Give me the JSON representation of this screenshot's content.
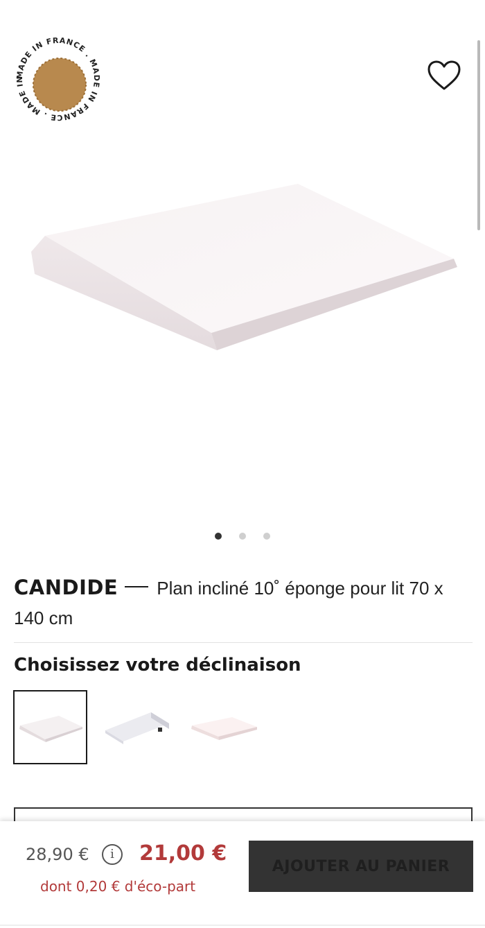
{
  "gallery": {
    "badge_icon": "made-in-france-seal",
    "badge_text": "MADE IN FRANCE . MADE IN FRANCE . MADE IN FRANCE",
    "favorite_icon": "heart-icon",
    "dots_count": 3,
    "active_dot": 0
  },
  "product": {
    "brand": "CANDIDE",
    "name": "Plan incliné 10˚ éponge pour lit 70 x 140 cm"
  },
  "variants": {
    "title": "Choisissez votre déclinaison",
    "items": [
      "variant-flat-white",
      "variant-grey-wedge",
      "variant-flat-pink"
    ],
    "selected_index": 0
  },
  "pricing": {
    "old_price": "28,90 €",
    "info_symbol": "i",
    "new_price": "21,00 €",
    "eco_part": "dont 0,20 € d'éco-part",
    "accent_color": "#b23a3a"
  },
  "cart": {
    "button_label": "AJOUTER AU PANIER"
  }
}
